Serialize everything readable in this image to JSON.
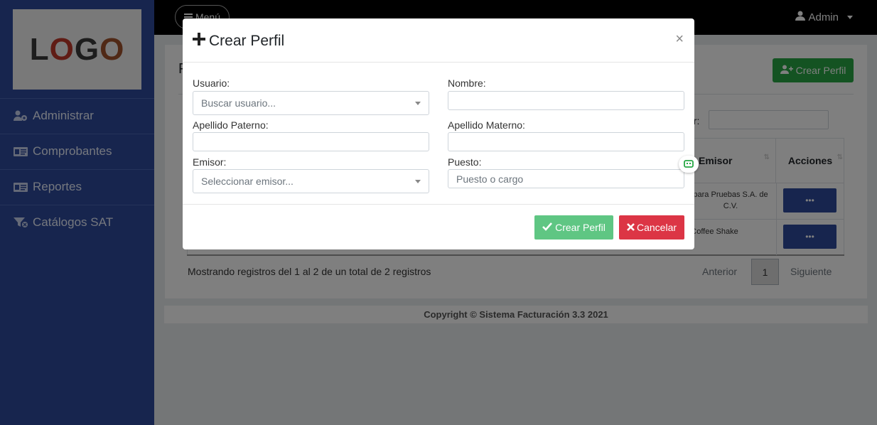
{
  "brand": {
    "logo_letters": [
      "L",
      "O",
      "G",
      "O"
    ],
    "logo_colors": [
      "#3a3a3a",
      "#c0392b",
      "#3a3a3a",
      "#3a3a3a"
    ]
  },
  "sidebar": {
    "items": [
      {
        "label": "Administrar",
        "icon": "users-cog-icon"
      },
      {
        "label": "Comprobantes",
        "icon": "id-card-icon"
      },
      {
        "label": "Reportes",
        "icon": "id-card-icon"
      },
      {
        "label": "Catálogos SAT",
        "icon": "filter-icon"
      }
    ]
  },
  "topbar": {
    "menu_label": "Menú",
    "user_label": "Admin"
  },
  "page": {
    "title_initial": "P",
    "create_button": "Crear Perfil",
    "search_label": "ar:",
    "table": {
      "headers": [
        "Emisor",
        "Acciones"
      ],
      "rows": [
        {
          "emisor": "para Pruebas S.A. de C.V.",
          "action": "•••"
        },
        {
          "emisor": "Coffee Shake",
          "action": "•••"
        }
      ]
    },
    "showing": "Mostrando registros del 1 al 2 de un total de 2 registros",
    "pagination": {
      "prev": "Anterior",
      "current": "1",
      "next": "Siguiente"
    }
  },
  "footer": {
    "text": "Copyright © Sistema Facturación 3.3 2021"
  },
  "modal": {
    "title": "Crear Perfil",
    "close": "×",
    "fields": {
      "usuario": {
        "label": "Usuario:",
        "placeholder": "Buscar usuario..."
      },
      "nombre": {
        "label": "Nombre:",
        "value": ""
      },
      "apellido_paterno": {
        "label": "Apellido Paterno:",
        "value": ""
      },
      "apellido_materno": {
        "label": "Apellido Materno:",
        "value": ""
      },
      "emisor": {
        "label": "Emisor:",
        "placeholder": "Seleccionar emisor..."
      },
      "puesto": {
        "label": "Puesto:",
        "placeholder": "Puesto o cargo"
      }
    },
    "submit": "Crear Perfil",
    "cancel": "Cancelar"
  },
  "colors": {
    "sidebar": "#2e4b9c",
    "success": "#28a745",
    "danger": "#dc3545",
    "primary_dark": "#2e4b9c"
  }
}
